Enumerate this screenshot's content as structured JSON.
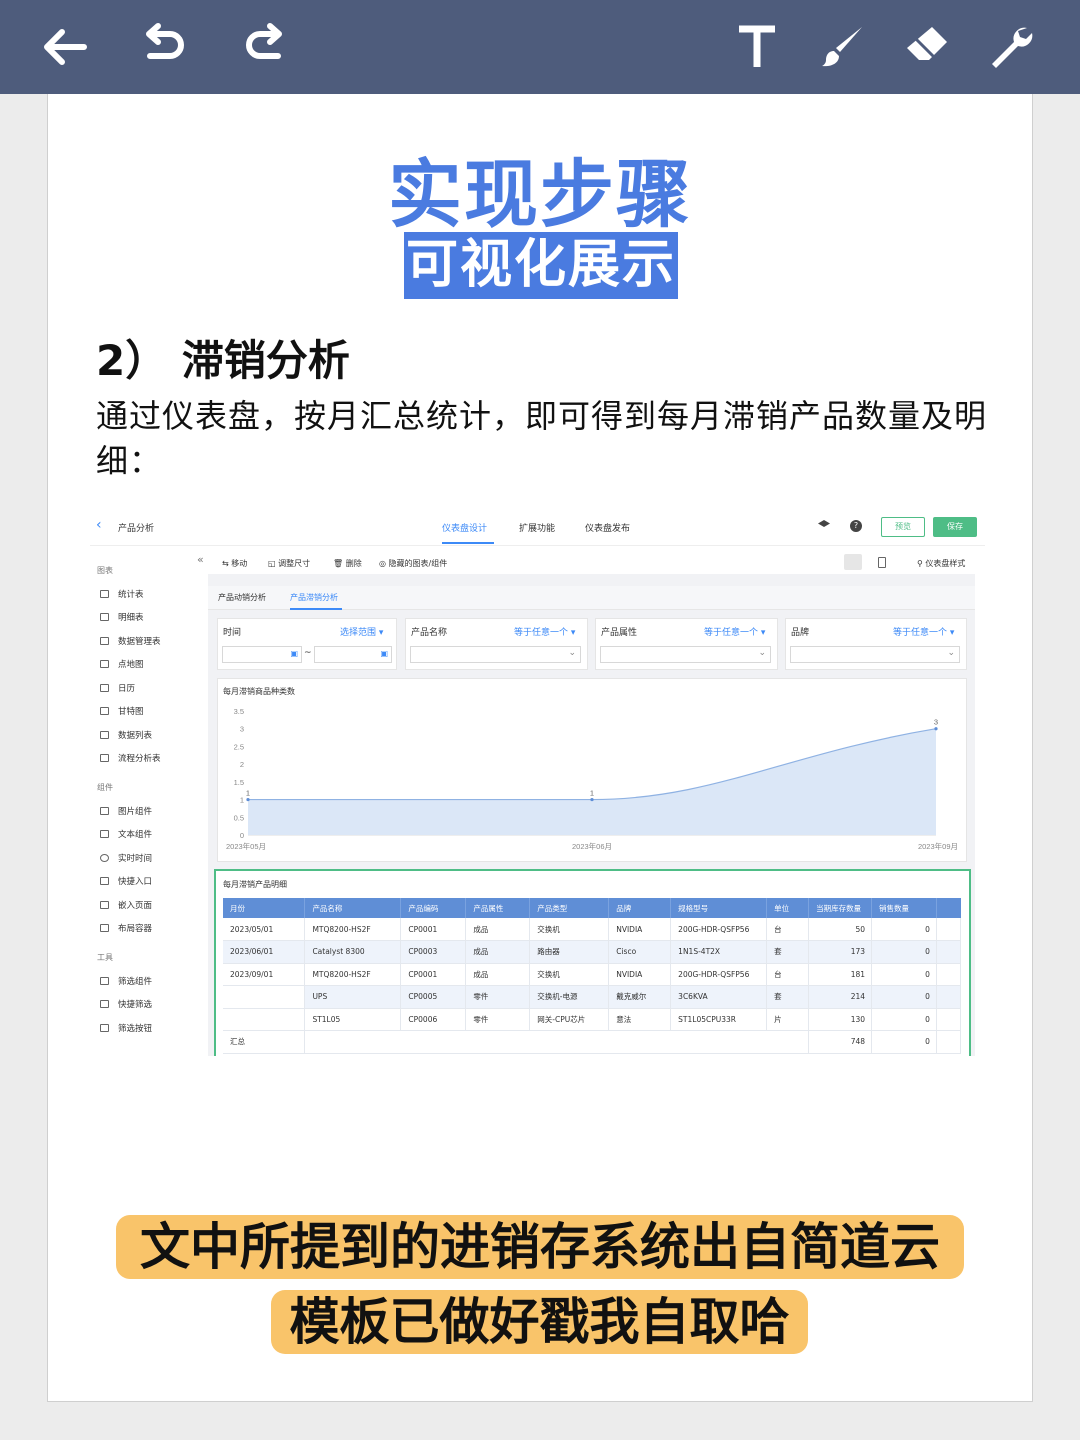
{
  "editor": {
    "icons": [
      "back-arrow",
      "undo",
      "redo",
      "text-tool",
      "brush-tool",
      "eraser-tool",
      "wrench-tool"
    ]
  },
  "title": {
    "line1": "实现步骤",
    "line2": "可视化展示"
  },
  "section": {
    "heading": "2） 滞销分析",
    "description": "通过仪表盘，按月汇总统计，即可得到每月滞销产品数量及明细："
  },
  "app": {
    "back_label": "产品分析",
    "top_tabs": [
      "仪表盘设计",
      "扩展功能",
      "仪表盘发布"
    ],
    "preview_label": "预览",
    "save_label": "保存",
    "toolbar": [
      "移动",
      "调整尺寸",
      "删除",
      "隐藏的图表/组件"
    ],
    "style_label": "仪表盘样式",
    "sidebar": {
      "chart_section": "图表",
      "chart_items": [
        "统计表",
        "明细表",
        "数据管理表",
        "点地图",
        "日历",
        "甘特图",
        "数据列表",
        "流程分析表"
      ],
      "component_section": "组件",
      "component_items": [
        "图片组件",
        "文本组件",
        "实时时间",
        "快捷入口",
        "嵌入页面",
        "布局容器"
      ],
      "tool_section": "工具",
      "tool_items": [
        "筛选组件",
        "快捷筛选",
        "筛选按钮"
      ]
    },
    "page_tabs": [
      "产品动销分析",
      "产品滞销分析"
    ],
    "filters": [
      {
        "label": "时间",
        "mode": "选择范围"
      },
      {
        "label": "产品名称",
        "mode": "等于任意一个"
      },
      {
        "label": "产品属性",
        "mode": "等于任意一个"
      },
      {
        "label": "品牌",
        "mode": "等于任意一个"
      }
    ],
    "date_sep": "~",
    "table_title": "每月滞销产品明细",
    "table": {
      "headers": [
        "月份",
        "产品名称",
        "产品编码",
        "产品属性",
        "产品类型",
        "品牌",
        "规格型号",
        "单位",
        "当期库存数量",
        "销售数量"
      ],
      "rows": [
        [
          "2023/05/01",
          "MTQ8200-HS2F",
          "CP0001",
          "成品",
          "交换机",
          "NVIDIA",
          "200G-HDR-QSFP56",
          "台",
          "50",
          "0"
        ],
        [
          "2023/06/01",
          "Catalyst 8300",
          "CP0003",
          "成品",
          "路由器",
          "Cisco",
          "1N1S-4T2X",
          "套",
          "173",
          "0"
        ],
        [
          "2023/09/01",
          "MTQ8200-HS2F",
          "CP0001",
          "成品",
          "交换机",
          "NVIDIA",
          "200G-HDR-QSFP56",
          "台",
          "181",
          "0"
        ],
        [
          "",
          "UPS",
          "CP0005",
          "零件",
          "交换机-电源",
          "戴克威尔",
          "3C6KVA",
          "套",
          "214",
          "0"
        ],
        [
          "",
          "ST1L05",
          "CP0006",
          "零件",
          "网关-CPU芯片",
          "意法",
          "ST1L05CPU33R",
          "片",
          "130",
          "0"
        ]
      ],
      "total_label": "汇总",
      "total_stock": "748",
      "total_sales": "0"
    }
  },
  "chart_data": {
    "type": "area",
    "title": "每月滞销商品种类数",
    "x": [
      "2023年05月",
      "2023年06月",
      "2023年09月"
    ],
    "values": [
      1,
      1,
      3
    ],
    "data_labels": [
      "1",
      "1",
      "3"
    ],
    "ylim": [
      0,
      3.5
    ],
    "yticks": [
      "0",
      "0.5",
      "1",
      "1.5",
      "2",
      "2.5",
      "3",
      "3.5"
    ],
    "xlabel": "",
    "ylabel": "",
    "color": "#8fb2e3"
  },
  "banner": {
    "line1": "文中所提到的进销存系统出自简道云",
    "line2": "模板已做好戳我自取哈"
  },
  "colors": {
    "topbar": "#4e5c7c",
    "accent_blue": "#4a7be0",
    "banner": "#f9c46a",
    "app_green": "#4ebd86",
    "app_tab_blue": "#3d8af7"
  }
}
